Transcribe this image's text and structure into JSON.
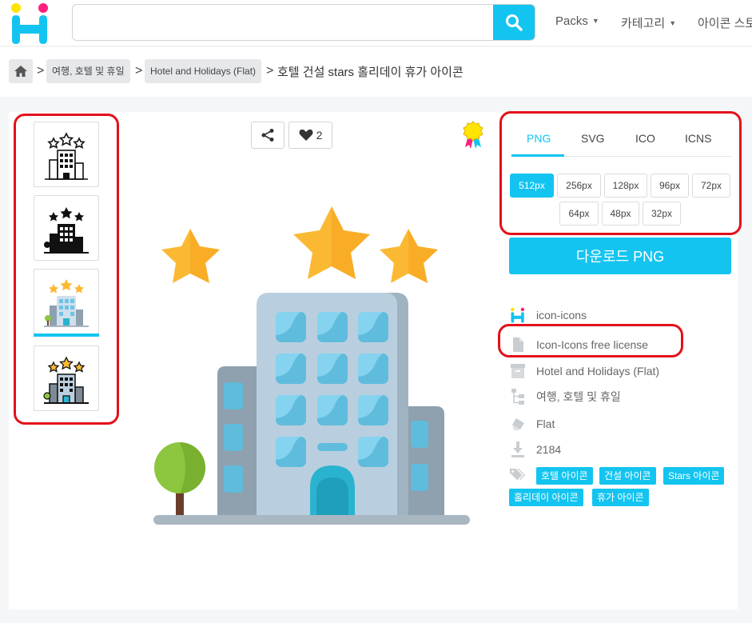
{
  "header": {
    "search_placeholder": "",
    "nav": [
      {
        "label": "Packs"
      },
      {
        "label": "카테고리"
      },
      {
        "label": "아이콘 스토"
      }
    ]
  },
  "breadcrumb": {
    "items": [
      "여행, 호텔 및 휴일",
      "Hotel and Holidays (Flat)"
    ],
    "current": "호텔 건설 stars 홀리데이 휴가 아이콘",
    "separator": ">"
  },
  "toolbar": {
    "likes": "2"
  },
  "formats": {
    "tabs": [
      "PNG",
      "SVG",
      "ICO",
      "ICNS"
    ],
    "selected": "PNG",
    "sizes": [
      "512px",
      "256px",
      "128px",
      "96px",
      "72px",
      "64px",
      "48px",
      "32px"
    ],
    "selected_size": "512px"
  },
  "download": {
    "label": "다운로드 PNG"
  },
  "info": {
    "author": "icon-icons",
    "license": "Icon-Icons free license",
    "pack": "Hotel and Holidays (Flat)",
    "category": "여행, 호텔 및 휴일",
    "style": "Flat",
    "downloads": "2184"
  },
  "tags": [
    "호텔 아이콘",
    "건설 아이콘",
    "Stars 아이콘",
    "홀리데이 아이콘",
    "휴가 아이콘"
  ],
  "colors": {
    "accent": "#14c4f0",
    "highlight": "#e3101a",
    "logo_yellow": "#ffe400",
    "logo_pink": "#ff1f7c"
  }
}
